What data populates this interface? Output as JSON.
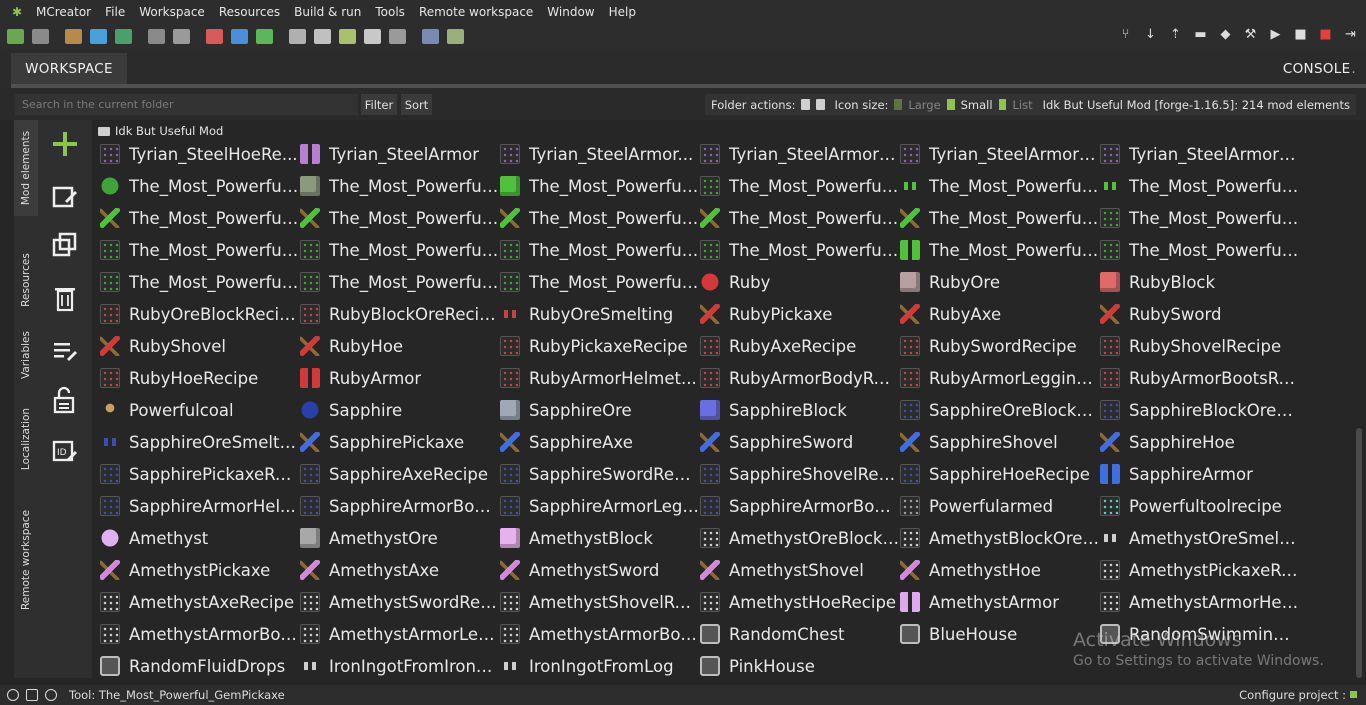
{
  "app": {
    "title": "MCreator"
  },
  "menu": [
    "File",
    "Workspace",
    "Resources",
    "Build & run",
    "Tools",
    "Remote workspace",
    "Window",
    "Help"
  ],
  "tabs": {
    "workspace": "WORKSPACE",
    "console": "CONSOLE",
    "console_dot": "."
  },
  "search": {
    "placeholder": "Search in the current folder",
    "filter": "Filter",
    "sort": "Sort"
  },
  "folder_bar": {
    "actions_label": "Folder actions:",
    "icon_size_label": "Icon size:",
    "sizes": [
      "Large",
      "Small",
      "List"
    ],
    "selected_size": "Small",
    "workspace_info": "Idk But Useful Mod [forge-1.16.5]: 214 mod elements"
  },
  "side_tabs": [
    "Mod elements",
    "Resources",
    "Variables",
    "Localization",
    "Remote workspace"
  ],
  "breadcrumb": "Idk But Useful Mod",
  "elements": [
    {
      "name": "Tyrian_SteelHoeRe...",
      "icon": "recipe-grid-icon",
      "color": "#8a5fb5"
    },
    {
      "name": "Tyrian_SteelArmor",
      "icon": "armor-icon",
      "color": "#b77fd0"
    },
    {
      "name": "Tyrian_SteelArmor...",
      "icon": "recipe-grid-icon",
      "color": "#8a5fb5"
    },
    {
      "name": "Tyrian_SteelArmorB...",
      "icon": "recipe-grid-icon",
      "color": "#8a5fb5"
    },
    {
      "name": "Tyrian_SteelArmorL...",
      "icon": "recipe-grid-icon",
      "color": "#8a5fb5"
    },
    {
      "name": "Tyrian_SteelArmorB...",
      "icon": "recipe-grid-icon",
      "color": "#8a5fb5"
    },
    {
      "name": "The_Most_Powerful...",
      "icon": "gem-icon",
      "color": "#3fa33a"
    },
    {
      "name": "The_Most_Powerful...",
      "icon": "ore-block-icon",
      "color": "#8a9a7f"
    },
    {
      "name": "The_Most_Powerful...",
      "icon": "block-icon",
      "color": "#4fc23a"
    },
    {
      "name": "The_Most_Powerful...",
      "icon": "recipe-grid-icon",
      "color": "#3fa33a"
    },
    {
      "name": "The_Most_Powerful...",
      "icon": "smelting-icon",
      "color": "#4fc23a"
    },
    {
      "name": "The_Most_Powerful...",
      "icon": "smelting-icon",
      "color": "#4fc23a"
    },
    {
      "name": "The_Most_Powerful...",
      "icon": "pickaxe-icon",
      "color": "#4fc23a"
    },
    {
      "name": "The_Most_Powerful...",
      "icon": "axe-icon",
      "color": "#4fc23a"
    },
    {
      "name": "The_Most_Powerful...",
      "icon": "sword-icon",
      "color": "#4fc23a"
    },
    {
      "name": "The_Most_Powerful...",
      "icon": "shovel-icon",
      "color": "#4fc23a"
    },
    {
      "name": "The_Most_Powerful...",
      "icon": "hoe-icon",
      "color": "#4fc23a"
    },
    {
      "name": "The_Most_Powerful...",
      "icon": "recipe-grid-icon",
      "color": "#3fa33a"
    },
    {
      "name": "The_Most_Powerful...",
      "icon": "recipe-grid-icon",
      "color": "#3fa33a"
    },
    {
      "name": "The_Most_Powerful...",
      "icon": "recipe-grid-icon",
      "color": "#3fa33a"
    },
    {
      "name": "The_Most_Powerful...",
      "icon": "recipe-grid-icon",
      "color": "#3fa33a"
    },
    {
      "name": "The_Most_Powerful...",
      "icon": "recipe-grid-icon",
      "color": "#3fa33a"
    },
    {
      "name": "The_Most_Powerful...",
      "icon": "armor-icon",
      "color": "#4fc23a"
    },
    {
      "name": "The_Most_Powerful...",
      "icon": "recipe-grid-icon",
      "color": "#3fa33a"
    },
    {
      "name": "The_Most_Powerful...",
      "icon": "recipe-grid-icon",
      "color": "#3fa33a"
    },
    {
      "name": "The_Most_Powerful...",
      "icon": "recipe-grid-icon",
      "color": "#3fa33a"
    },
    {
      "name": "The_Most_Powerful...",
      "icon": "recipe-grid-icon",
      "color": "#3fa33a"
    },
    {
      "name": "Ruby",
      "icon": "gem-icon",
      "color": "#d23a3a"
    },
    {
      "name": "RubyOre",
      "icon": "ore-block-icon",
      "color": "#b9a0a0"
    },
    {
      "name": "RubyBlock",
      "icon": "block-icon",
      "color": "#e06a6a"
    },
    {
      "name": "RubyOreBlockRecipe",
      "icon": "recipe-grid-icon",
      "color": "#c24545"
    },
    {
      "name": "RubyBlockOreRecipe",
      "icon": "recipe-grid-icon",
      "color": "#c24545"
    },
    {
      "name": "RubyOreSmelting",
      "icon": "smelting-icon",
      "color": "#c24545"
    },
    {
      "name": "RubyPickaxe",
      "icon": "pickaxe-icon",
      "color": "#d23a3a"
    },
    {
      "name": "RubyAxe",
      "icon": "axe-icon",
      "color": "#d23a3a"
    },
    {
      "name": "RubySword",
      "icon": "sword-icon",
      "color": "#d23a3a"
    },
    {
      "name": "RubyShovel",
      "icon": "shovel-icon",
      "color": "#d23a3a"
    },
    {
      "name": "RubyHoe",
      "icon": "hoe-icon",
      "color": "#d23a3a"
    },
    {
      "name": "RubyPickaxeRecipe",
      "icon": "recipe-grid-icon",
      "color": "#c24545"
    },
    {
      "name": "RubyAxeRecipe",
      "icon": "recipe-grid-icon",
      "color": "#c24545"
    },
    {
      "name": "RubySwordRecipe",
      "icon": "recipe-grid-icon",
      "color": "#c24545"
    },
    {
      "name": "RubyShovelRecipe",
      "icon": "recipe-grid-icon",
      "color": "#c24545"
    },
    {
      "name": "RubyHoeRecipe",
      "icon": "recipe-grid-icon",
      "color": "#c24545"
    },
    {
      "name": "RubyArmor",
      "icon": "armor-icon",
      "color": "#d23a3a"
    },
    {
      "name": "RubyArmorHelmet...",
      "icon": "recipe-grid-icon",
      "color": "#c24545"
    },
    {
      "name": "RubyArmorBodyRe...",
      "icon": "recipe-grid-icon",
      "color": "#c24545"
    },
    {
      "name": "RubyArmorLegging...",
      "icon": "recipe-grid-icon",
      "color": "#c24545"
    },
    {
      "name": "RubyArmorBootsRe...",
      "icon": "recipe-grid-icon",
      "color": "#c24545"
    },
    {
      "name": "Powerfulcoal",
      "icon": "coal-icon",
      "color": "#caa060"
    },
    {
      "name": "Sapphire",
      "icon": "gem-icon",
      "color": "#2a3fa8"
    },
    {
      "name": "SapphireOre",
      "icon": "ore-block-icon",
      "color": "#a0a8b8"
    },
    {
      "name": "SapphireBlock",
      "icon": "block-icon",
      "color": "#6b6ee0"
    },
    {
      "name": "SapphireOreBlockR...",
      "icon": "recipe-grid-icon",
      "color": "#3f4fb0"
    },
    {
      "name": "SapphireBlockOreR...",
      "icon": "recipe-grid-icon",
      "color": "#3f4fb0"
    },
    {
      "name": "SapphireOreSmelting",
      "icon": "smelting-icon",
      "color": "#3f4fb0"
    },
    {
      "name": "SapphirePickaxe",
      "icon": "pickaxe-icon",
      "color": "#3f6ee0"
    },
    {
      "name": "SapphireAxe",
      "icon": "axe-icon",
      "color": "#3f6ee0"
    },
    {
      "name": "SapphireSword",
      "icon": "sword-icon",
      "color": "#3f6ee0"
    },
    {
      "name": "SapphireShovel",
      "icon": "shovel-icon",
      "color": "#3f6ee0"
    },
    {
      "name": "SapphireHoe",
      "icon": "hoe-icon",
      "color": "#3f6ee0"
    },
    {
      "name": "SapphirePickaxeRe...",
      "icon": "recipe-grid-icon",
      "color": "#3f4fb0"
    },
    {
      "name": "SapphireAxeRecipe",
      "icon": "recipe-grid-icon",
      "color": "#3f4fb0"
    },
    {
      "name": "SapphireSwordReci...",
      "icon": "recipe-grid-icon",
      "color": "#3f4fb0"
    },
    {
      "name": "SapphireShovelReci...",
      "icon": "recipe-grid-icon",
      "color": "#3f4fb0"
    },
    {
      "name": "SapphireHoeRecipe",
      "icon": "recipe-grid-icon",
      "color": "#3f4fb0"
    },
    {
      "name": "SapphireArmor",
      "icon": "armor-icon",
      "color": "#3f6ee0"
    },
    {
      "name": "SapphireArmorHel...",
      "icon": "recipe-grid-icon",
      "color": "#3f4fb0"
    },
    {
      "name": "SapphireArmorBod...",
      "icon": "recipe-grid-icon",
      "color": "#3f4fb0"
    },
    {
      "name": "SapphireArmorLegg...",
      "icon": "recipe-grid-icon",
      "color": "#3f4fb0"
    },
    {
      "name": "SapphireArmorBoot...",
      "icon": "recipe-grid-icon",
      "color": "#3f4fb0"
    },
    {
      "name": "Powerfularmed",
      "icon": "recipe-grid-icon",
      "color": "#9a9a9a"
    },
    {
      "name": "Powerfultoolrecipe",
      "icon": "recipe-grid-icon",
      "color": "#4fd0c8"
    },
    {
      "name": "Amethyst",
      "icon": "gem-icon",
      "color": "#e0b0f0"
    },
    {
      "name": "AmethystOre",
      "icon": "ore-block-icon",
      "color": "#a8a8a8"
    },
    {
      "name": "AmethystBlock",
      "icon": "block-icon",
      "color": "#e8b0ec"
    },
    {
      "name": "AmethystOreBlockR...",
      "icon": "recipe-grid-icon",
      "color": "#cfcfcf"
    },
    {
      "name": "AmethystBlockOreR...",
      "icon": "recipe-grid-icon",
      "color": "#cfcfcf"
    },
    {
      "name": "AmethystOreSmelti...",
      "icon": "smelting-icon",
      "color": "#cfcfcf"
    },
    {
      "name": "AmethystPickaxe",
      "icon": "pickaxe-icon",
      "color": "#d08ad8"
    },
    {
      "name": "AmethystAxe",
      "icon": "axe-icon",
      "color": "#d08ad8"
    },
    {
      "name": "AmethystSword",
      "icon": "sword-icon",
      "color": "#d08ad8"
    },
    {
      "name": "AmethystShovel",
      "icon": "shovel-icon",
      "color": "#d08ad8"
    },
    {
      "name": "AmethystHoe",
      "icon": "hoe-icon",
      "color": "#d08ad8"
    },
    {
      "name": "AmethystPickaxeRe...",
      "icon": "recipe-grid-icon",
      "color": "#cfcfcf"
    },
    {
      "name": "AmethystAxeRecipe",
      "icon": "recipe-grid-icon",
      "color": "#cfcfcf"
    },
    {
      "name": "AmethystSwordRec...",
      "icon": "recipe-grid-icon",
      "color": "#cfcfcf"
    },
    {
      "name": "AmethystShovelRe...",
      "icon": "recipe-grid-icon",
      "color": "#cfcfcf"
    },
    {
      "name": "AmethystHoeRecipe",
      "icon": "recipe-grid-icon",
      "color": "#cfcfcf"
    },
    {
      "name": "AmethystArmor",
      "icon": "armor-icon",
      "color": "#e0a8f0"
    },
    {
      "name": "AmethystArmorHel...",
      "icon": "recipe-grid-icon",
      "color": "#cfcfcf"
    },
    {
      "name": "AmethystArmorBod...",
      "icon": "recipe-grid-icon",
      "color": "#cfcfcf"
    },
    {
      "name": "AmethystArmorLeg...",
      "icon": "recipe-grid-icon",
      "color": "#cfcfcf"
    },
    {
      "name": "AmethystArmorBoo...",
      "icon": "recipe-grid-icon",
      "color": "#cfcfcf"
    },
    {
      "name": "RandomChest",
      "icon": "structure-icon",
      "color": "#bdbdbd"
    },
    {
      "name": "BlueHouse",
      "icon": "structure-icon",
      "color": "#bdbdbd"
    },
    {
      "name": "RandomSwimming...",
      "icon": "structure-icon",
      "color": "#bdbdbd"
    },
    {
      "name": "RandomFluidDrops",
      "icon": "structure-icon",
      "color": "#bdbdbd"
    },
    {
      "name": "IronIngotFromIronP...",
      "icon": "smelting-icon",
      "color": "#cfcfcf"
    },
    {
      "name": "IronIngotFromLog",
      "icon": "smelting-icon",
      "color": "#cfcfcf"
    },
    {
      "name": "PinkHouse",
      "icon": "structure-icon",
      "color": "#bdbdbd"
    }
  ],
  "watermark": {
    "title": "Activate Windows",
    "subtitle": "Go to Settings to activate Windows."
  },
  "status": {
    "tool": "Tool: The_Most_Powerful_GemPickaxe",
    "configure": "Configure project :"
  },
  "colors": {
    "accent": "#8ec44e",
    "background": "#262626",
    "panel": "#2f2f2f"
  }
}
